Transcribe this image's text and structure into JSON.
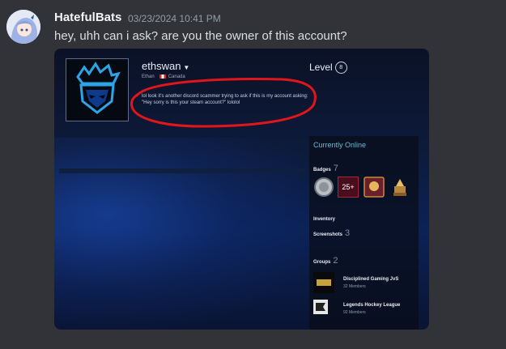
{
  "message": {
    "author": "HatefulBats",
    "timestamp": "03/23/2024 10:41 PM",
    "text": "hey, uhh can i ask? are you the owner of this account?"
  },
  "profile": {
    "name": "ethswan",
    "real_name": "Ethan",
    "country": "Canada",
    "summary": "lol look it's another discord scammer trying to ask if this is my account asking: \"Hey sorry is this your steam account?\" lololol",
    "level_label": "Level",
    "level": "8",
    "status": "Currently Online",
    "badges_label": "Badges",
    "badges_count": "7",
    "badge_25_text": "25+",
    "inventory_label": "Inventory",
    "screenshots_label": "Screenshots",
    "screenshots_count": "3",
    "groups_label": "Groups",
    "groups_count": "2",
    "groups": [
      {
        "name": "Disciplined Gaming JvS",
        "members": "32 Members"
      },
      {
        "name": "Legends Hockey League",
        "members": "92 Members"
      }
    ]
  },
  "colors": {
    "annotation_circle": "#e0161b",
    "online_status": "#5dbcd2",
    "avatar_accent": "#2aa6e8"
  }
}
